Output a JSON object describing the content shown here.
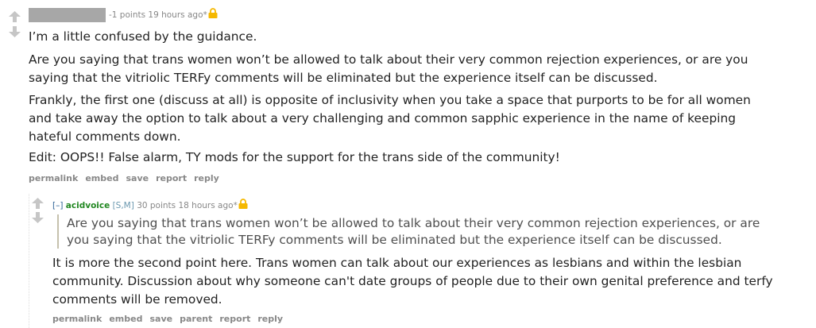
{
  "comment1": {
    "score": "-1 points",
    "time": "19 hours ago",
    "edited_marker": "*",
    "paragraphs": [
      "I’m a little confused by the guidance.",
      "Are you saying that trans women won’t be allowed to talk about their very common rejection experiences, or are you",
      "saying that the vitriolic TERFy comments will be eliminated but the experience itself can be discussed.",
      "Frankly, the first one (discuss at all) is opposite of inclusivity when you take a space that purports to be for all women",
      "and take away the option to talk about a very challenging and common sapphic experience in the name of keeping",
      "hateful comments down.",
      "Edit: OOPS!! False alarm, TY mods for the support for the trans side of the community!"
    ],
    "buttons": [
      "permalink",
      "embed",
      "save",
      "report",
      "reply"
    ]
  },
  "comment2": {
    "collapse_label": "[–]",
    "author": "acidvoice",
    "flair": "[S,M]",
    "score": "30 points",
    "time": "18 hours ago",
    "edited_marker": "*",
    "quote_lines": [
      "Are you saying that trans women won’t be allowed to talk about their very common rejection experiences, or are",
      "you saying that the vitriolic TERFy comments will be eliminated but the experience itself can be discussed."
    ],
    "paragraph_lines": [
      "It is more the second point here. Trans women can talk about our experiences as lesbians and within the lesbian",
      "community. Discussion about why someone can't date groups of people due to their own genital preference and terfy",
      "comments will be removed."
    ],
    "buttons": [
      "permalink",
      "embed",
      "save",
      "parent",
      "report",
      "reply"
    ]
  },
  "colors": {
    "author": "#228822",
    "lock": "#f5b800",
    "meta": "#888888",
    "arrow": "#c6c6c6"
  }
}
